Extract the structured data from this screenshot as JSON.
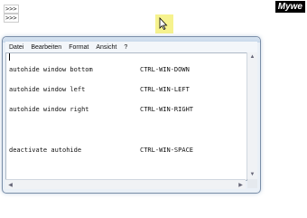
{
  "console": {
    "prompt_lines": [
      ">>>",
      ">>>"
    ]
  },
  "brand": {
    "label": "Mywe"
  },
  "window": {
    "menu": [
      "Datei",
      "Bearbeiten",
      "Format",
      "Ansicht",
      "?"
    ]
  },
  "editor": {
    "lines": [
      {
        "command": "autohide window bottom",
        "shortcut": "CTRL-WIN-DOWN"
      },
      {
        "command": "autohide window left",
        "shortcut": "CTRL-WIN-LEFT"
      },
      {
        "command": "autohide window right",
        "shortcut": "CTRL-WIN-RIGHT"
      },
      {
        "command": "",
        "shortcut": ""
      },
      {
        "command": "deactivate autohide",
        "shortcut": "CTRL-WIN-SPACE"
      }
    ]
  },
  "scrollbar_glyphs": {
    "up": "▲",
    "down": "▼",
    "left": "◀",
    "right": "▶"
  },
  "colors": {
    "highlight": "#f5f07a",
    "window_border": "#7a8ea8"
  }
}
